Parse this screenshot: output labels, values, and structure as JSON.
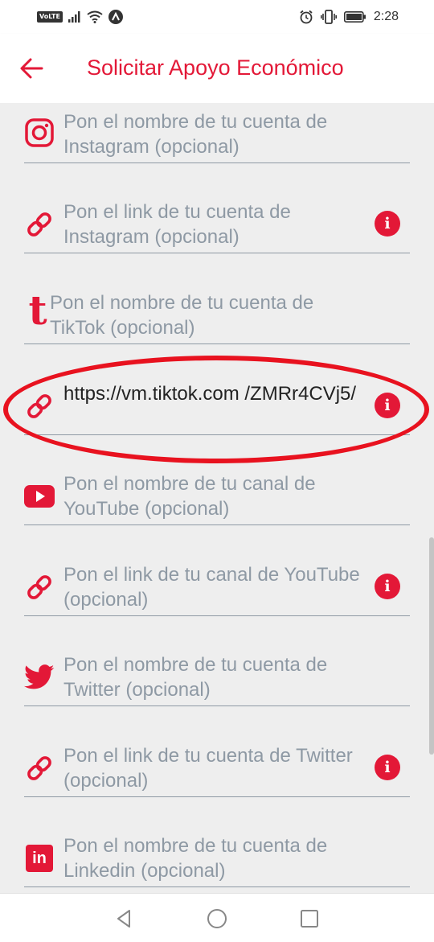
{
  "status_bar": {
    "network_badge": "VoLTE",
    "time": "2:28"
  },
  "header": {
    "title": "Solicitar Apoyo Económico",
    "back_icon": "arrow-left-icon"
  },
  "fields": [
    {
      "icon": "instagram-icon",
      "text": "Pon el nombre de tu cuenta de Instagram (opcional)",
      "is_value": false,
      "info": false
    },
    {
      "icon": "link-icon",
      "text": "Pon el link de tu cuenta de Instagram (opcional)",
      "is_value": false,
      "info": true
    },
    {
      "icon": "tiktok-icon",
      "icon_glyph": "t",
      "text": "Pon el nombre de tu cuenta de TikTok (opcional)",
      "is_value": false,
      "info": false
    },
    {
      "icon": "link-icon",
      "text": "https://vm.tiktok.com /ZMRr4CVj5/",
      "is_value": true,
      "info": true
    },
    {
      "icon": "youtube-icon",
      "text": "Pon el nombre de tu canal de YouTube (opcional)",
      "is_value": false,
      "info": false
    },
    {
      "icon": "link-icon",
      "text": "Pon el link de tu canal de YouTube (opcional)",
      "is_value": false,
      "info": true
    },
    {
      "icon": "twitter-icon",
      "text": "Pon el nombre de tu cuenta de Twitter (opcional)",
      "is_value": false,
      "info": false
    },
    {
      "icon": "link-icon",
      "text": "Pon el link de tu cuenta de Twitter (opcional)",
      "is_value": false,
      "info": true
    },
    {
      "icon": "linkedin-icon",
      "icon_glyph": "in",
      "text": "Pon el nombre de tu cuenta de Linkedin (opcional)",
      "is_value": false,
      "info": false
    }
  ],
  "info_glyph": "i",
  "colors": {
    "accent": "#e31837",
    "placeholder": "#8e99a4",
    "value_text": "#222222",
    "background": "#eeeeee",
    "highlight": "#e8121f"
  },
  "nav_bar": {
    "back_icon": "nav-back-triangle-icon",
    "home_icon": "nav-home-circle-icon",
    "recents_icon": "nav-recents-square-icon"
  }
}
